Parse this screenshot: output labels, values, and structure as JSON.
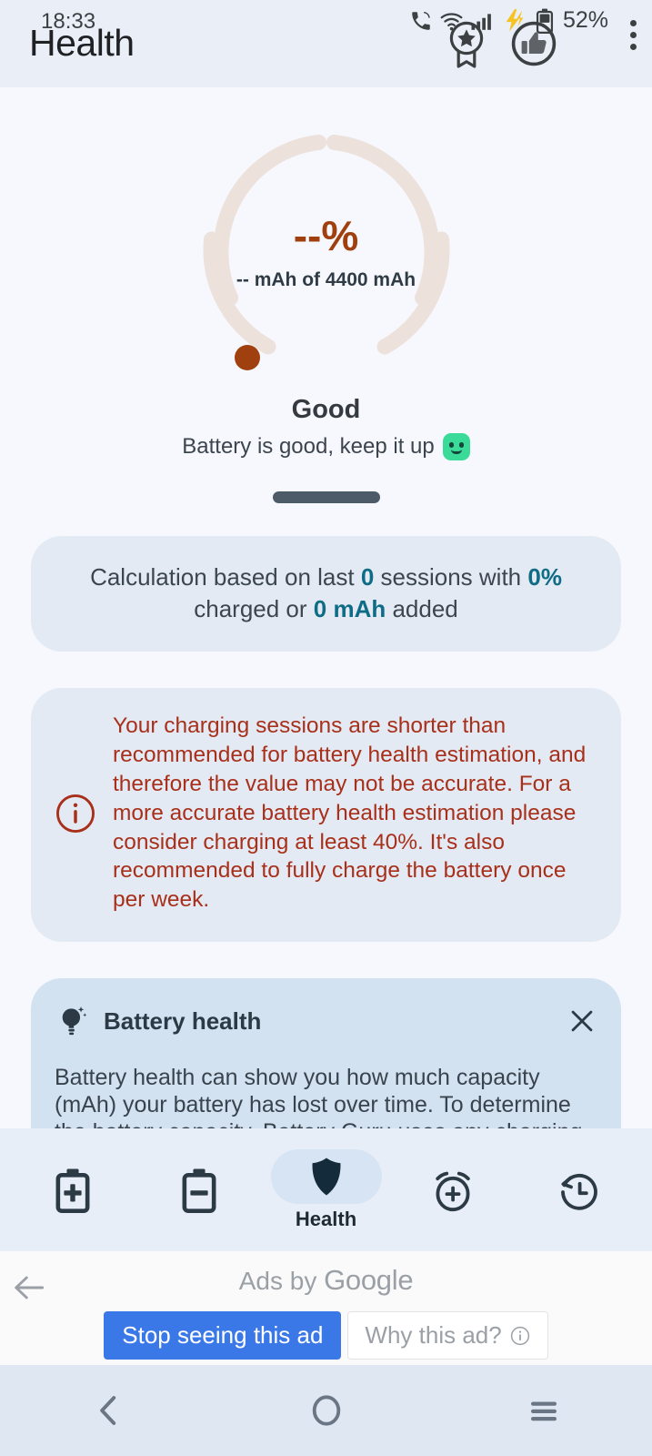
{
  "statusbar": {
    "time": "18:33",
    "battery_percent": "52%",
    "icons": [
      "phone-call-icon",
      "wifi-icon",
      "signal-bars-icon",
      "lightning-bolt-icon",
      "battery-icon",
      "star-ribbon-badge-icon",
      "thumbs-up-badge-icon",
      "overflow-menu-icon"
    ]
  },
  "appbar": {
    "title": "Health"
  },
  "gauge": {
    "percent": "--%",
    "capacity_line": "-- mAh of 4400 mAh",
    "ring_color": "#EDE1DB",
    "accent_color": "#A0400F",
    "status_title": "Good",
    "status_desc": "Battery is good, keep it up",
    "status_emoji": "green-smiley-face-emoji"
  },
  "calculation_card": {
    "prefix": "Calculation based on last ",
    "sessions": "0",
    "mid1": " sessions with ",
    "percent_charged": "0%",
    "mid2": " charged or ",
    "mah_added": "0 mAh",
    "suffix": " added",
    "highlight_color": "#0F6C86"
  },
  "warning_card": {
    "icon": "info-circle-icon",
    "text": "Your charging sessions are shorter than recommended for battery health estimation, and therefore the value may not be accurate. For a more accurate battery health estimation please consider charging at least 40%. It's also recommended to fully charge the battery once per week.",
    "text_color": "#A8301B"
  },
  "tip_card": {
    "icon": "lightbulb-sparkle-icon",
    "title": "Battery health",
    "close_icon": "close-icon",
    "body": "Battery health can show you how much capacity (mAh) your battery has lost over time. To determine the battery capacity, Battery Guru uses any charging"
  },
  "bottomnav": {
    "items": [
      {
        "name": "charge",
        "icon": "battery-plus-icon",
        "label": "",
        "active": false
      },
      {
        "name": "discharge",
        "icon": "battery-minus-icon",
        "label": "",
        "active": false
      },
      {
        "name": "health",
        "icon": "shield-icon",
        "label": "Health",
        "active": true
      },
      {
        "name": "alarm",
        "icon": "alarm-plus-icon",
        "label": "",
        "active": false
      },
      {
        "name": "history",
        "icon": "history-clock-icon",
        "label": "",
        "active": false
      }
    ]
  },
  "ad": {
    "back_icon": "back-arrow-icon",
    "ads_by_prefix": "Ads by ",
    "ads_by_brand": "Google",
    "stop_label": "Stop seeing this ad",
    "why_label": "Why this ad?",
    "why_icon": "info-icon",
    "stop_color": "#3B78E7"
  },
  "sysnav": {
    "back_icon": "system-back-icon",
    "home_icon": "system-home-icon",
    "recents_icon": "system-recents-icon"
  }
}
